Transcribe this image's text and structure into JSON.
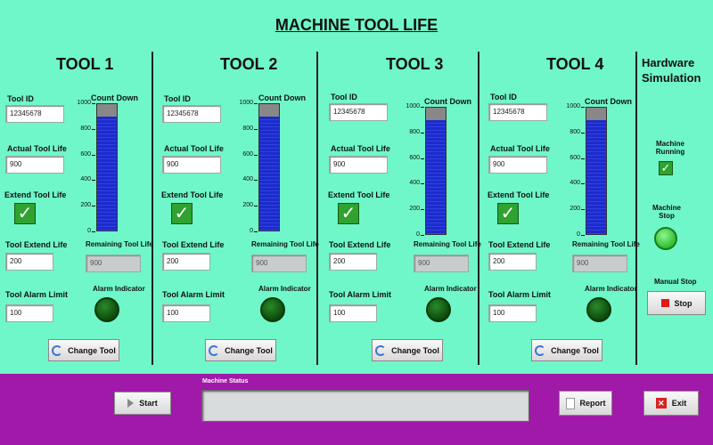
{
  "title": "MACHINE TOOL LIFE",
  "labels": {
    "tool_id": "Tool ID",
    "count_down": "Count Down",
    "actual_tool_life": "Actual Tool Life",
    "extend_tool_life": "Extend Tool Life",
    "tool_extend_life": "Tool Extend Life",
    "remaining_tool_life": "Remaining Tool Life",
    "tool_alarm_limit": "Tool Alarm Limit",
    "alarm_indicator": "Alarm Indicator",
    "change_tool": "Change Tool"
  },
  "gauge_ticks": [
    "1000",
    "800",
    "600",
    "400",
    "200",
    "0"
  ],
  "gauge_range": [
    0,
    1000
  ],
  "tools": [
    {
      "name": "TOOL 1",
      "tool_id": "12345678",
      "actual_tool_life": "900",
      "extend_checked": true,
      "tool_extend_life": "200",
      "remaining_tool_life": "900",
      "tool_alarm_limit": "100",
      "countdown_value": 900,
      "alarm_on": false
    },
    {
      "name": "TOOL 2",
      "tool_id": "12345678",
      "actual_tool_life": "900",
      "extend_checked": true,
      "tool_extend_life": "200",
      "remaining_tool_life": "900",
      "tool_alarm_limit": "100",
      "countdown_value": 900,
      "alarm_on": false
    },
    {
      "name": "TOOL 3",
      "tool_id": "12345678",
      "actual_tool_life": "900",
      "extend_checked": true,
      "tool_extend_life": "200",
      "remaining_tool_life": "900",
      "tool_alarm_limit": "100",
      "countdown_value": 900,
      "alarm_on": false
    },
    {
      "name": "TOOL 4",
      "tool_id": "12345678",
      "actual_tool_life": "900",
      "extend_checked": true,
      "tool_extend_life": "200",
      "remaining_tool_life": "900",
      "tool_alarm_limit": "100",
      "countdown_value": 900,
      "alarm_on": false
    }
  ],
  "hardware": {
    "title": "Hardware Simulation",
    "machine_running_label": "Machine Running",
    "machine_running_checked": true,
    "machine_stop_label": "Machine Stop",
    "machine_stop_on": true,
    "manual_stop_label": "Manual Stop",
    "stop_button": "Stop"
  },
  "bottom": {
    "start_button": "Start",
    "machine_status_label": "Machine Status",
    "machine_status_value": "",
    "report_button": "Report",
    "exit_button": "Exit"
  },
  "colors": {
    "background": "#6ff7c9",
    "bottom_bar": "#a119a8",
    "gauge_fill": "#1d2cc9",
    "check_green": "#2fa22f"
  }
}
